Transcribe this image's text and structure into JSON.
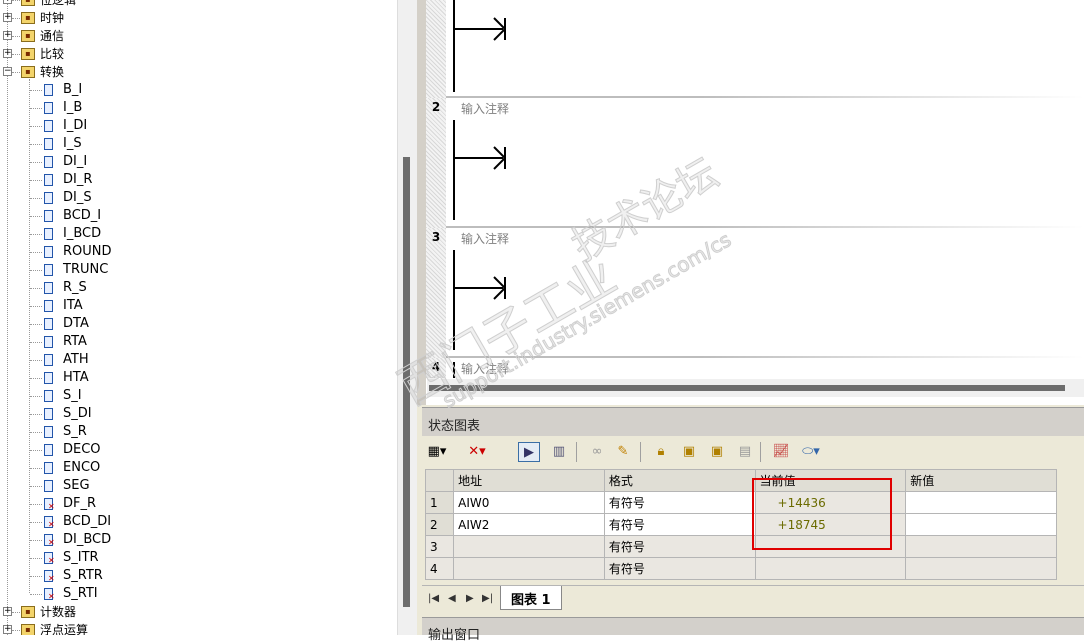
{
  "tree": {
    "folders": [
      {
        "label": "位逻辑",
        "expander": "+",
        "icon": "bit-logic-icon"
      },
      {
        "label": "时钟",
        "expander": "+",
        "icon": "clock-icon"
      },
      {
        "label": "通信",
        "expander": "+",
        "icon": "communication-icon"
      },
      {
        "label": "比较",
        "expander": "+",
        "icon": "compare-icon"
      },
      {
        "label": "转换",
        "expander": "−",
        "icon": "convert-icon"
      },
      {
        "label": "计数器",
        "expander": "+",
        "icon": "counter-icon"
      },
      {
        "label": "浮点运算",
        "expander": "+",
        "icon": "float-math-icon"
      }
    ],
    "instructions": [
      {
        "label": "B_I",
        "error": false
      },
      {
        "label": "I_B",
        "error": false
      },
      {
        "label": "I_DI",
        "error": false
      },
      {
        "label": "I_S",
        "error": false
      },
      {
        "label": "DI_I",
        "error": false
      },
      {
        "label": "DI_R",
        "error": false
      },
      {
        "label": "DI_S",
        "error": false
      },
      {
        "label": "BCD_I",
        "error": false
      },
      {
        "label": "I_BCD",
        "error": false
      },
      {
        "label": "ROUND",
        "error": false
      },
      {
        "label": "TRUNC",
        "error": false
      },
      {
        "label": "R_S",
        "error": false
      },
      {
        "label": "ITA",
        "error": false
      },
      {
        "label": "DTA",
        "error": false
      },
      {
        "label": "RTA",
        "error": false
      },
      {
        "label": "ATH",
        "error": false
      },
      {
        "label": "HTA",
        "error": false
      },
      {
        "label": "S_I",
        "error": false
      },
      {
        "label": "S_DI",
        "error": false
      },
      {
        "label": "S_R",
        "error": false
      },
      {
        "label": "DECO",
        "error": false
      },
      {
        "label": "ENCO",
        "error": false
      },
      {
        "label": "SEG",
        "error": false
      },
      {
        "label": "DF_R",
        "error": true
      },
      {
        "label": "BCD_DI",
        "error": true
      },
      {
        "label": "DI_BCD",
        "error": true
      },
      {
        "label": "S_ITR",
        "error": true
      },
      {
        "label": "S_RTR",
        "error": true
      },
      {
        "label": "S_RTI",
        "error": true
      }
    ]
  },
  "ladder": {
    "networks": [
      {
        "number": "",
        "comment": ""
      },
      {
        "number": "2",
        "comment": "输入注释"
      },
      {
        "number": "3",
        "comment": "输入注释"
      },
      {
        "number": "4",
        "comment": "输入注释"
      }
    ]
  },
  "status_chart": {
    "title": "状态图表",
    "toolbar_icons": [
      "insert-row-icon",
      "delete-row-icon",
      "chart-status-icon",
      "single-read-icon",
      "trend-glasses-icon",
      "write-pencil-icon",
      "lock-icon",
      "unlock-icon",
      "unlock-all-icon",
      "read-forced-icon",
      "trend-view-icon",
      "tag-icon"
    ],
    "columns": [
      "地址",
      "格式",
      "当前值",
      "新值"
    ],
    "rows": [
      {
        "num": "1",
        "address": "AIW0",
        "format": "有符号",
        "current": "+14436",
        "new": ""
      },
      {
        "num": "2",
        "address": "AIW2",
        "format": "有符号",
        "current": "+18745",
        "new": ""
      },
      {
        "num": "3",
        "address": "",
        "format": "有符号",
        "current": "",
        "new": ""
      },
      {
        "num": "4",
        "address": "",
        "format": "有符号",
        "current": "",
        "new": ""
      }
    ],
    "tab_label": "图表 1",
    "highlight_color": "#e00000"
  },
  "output_window": {
    "title": "输出窗口"
  },
  "watermark": {
    "line1": "西门子工业",
    "line2": "技术论坛",
    "url": "support.industry.siemens.com/cs"
  }
}
